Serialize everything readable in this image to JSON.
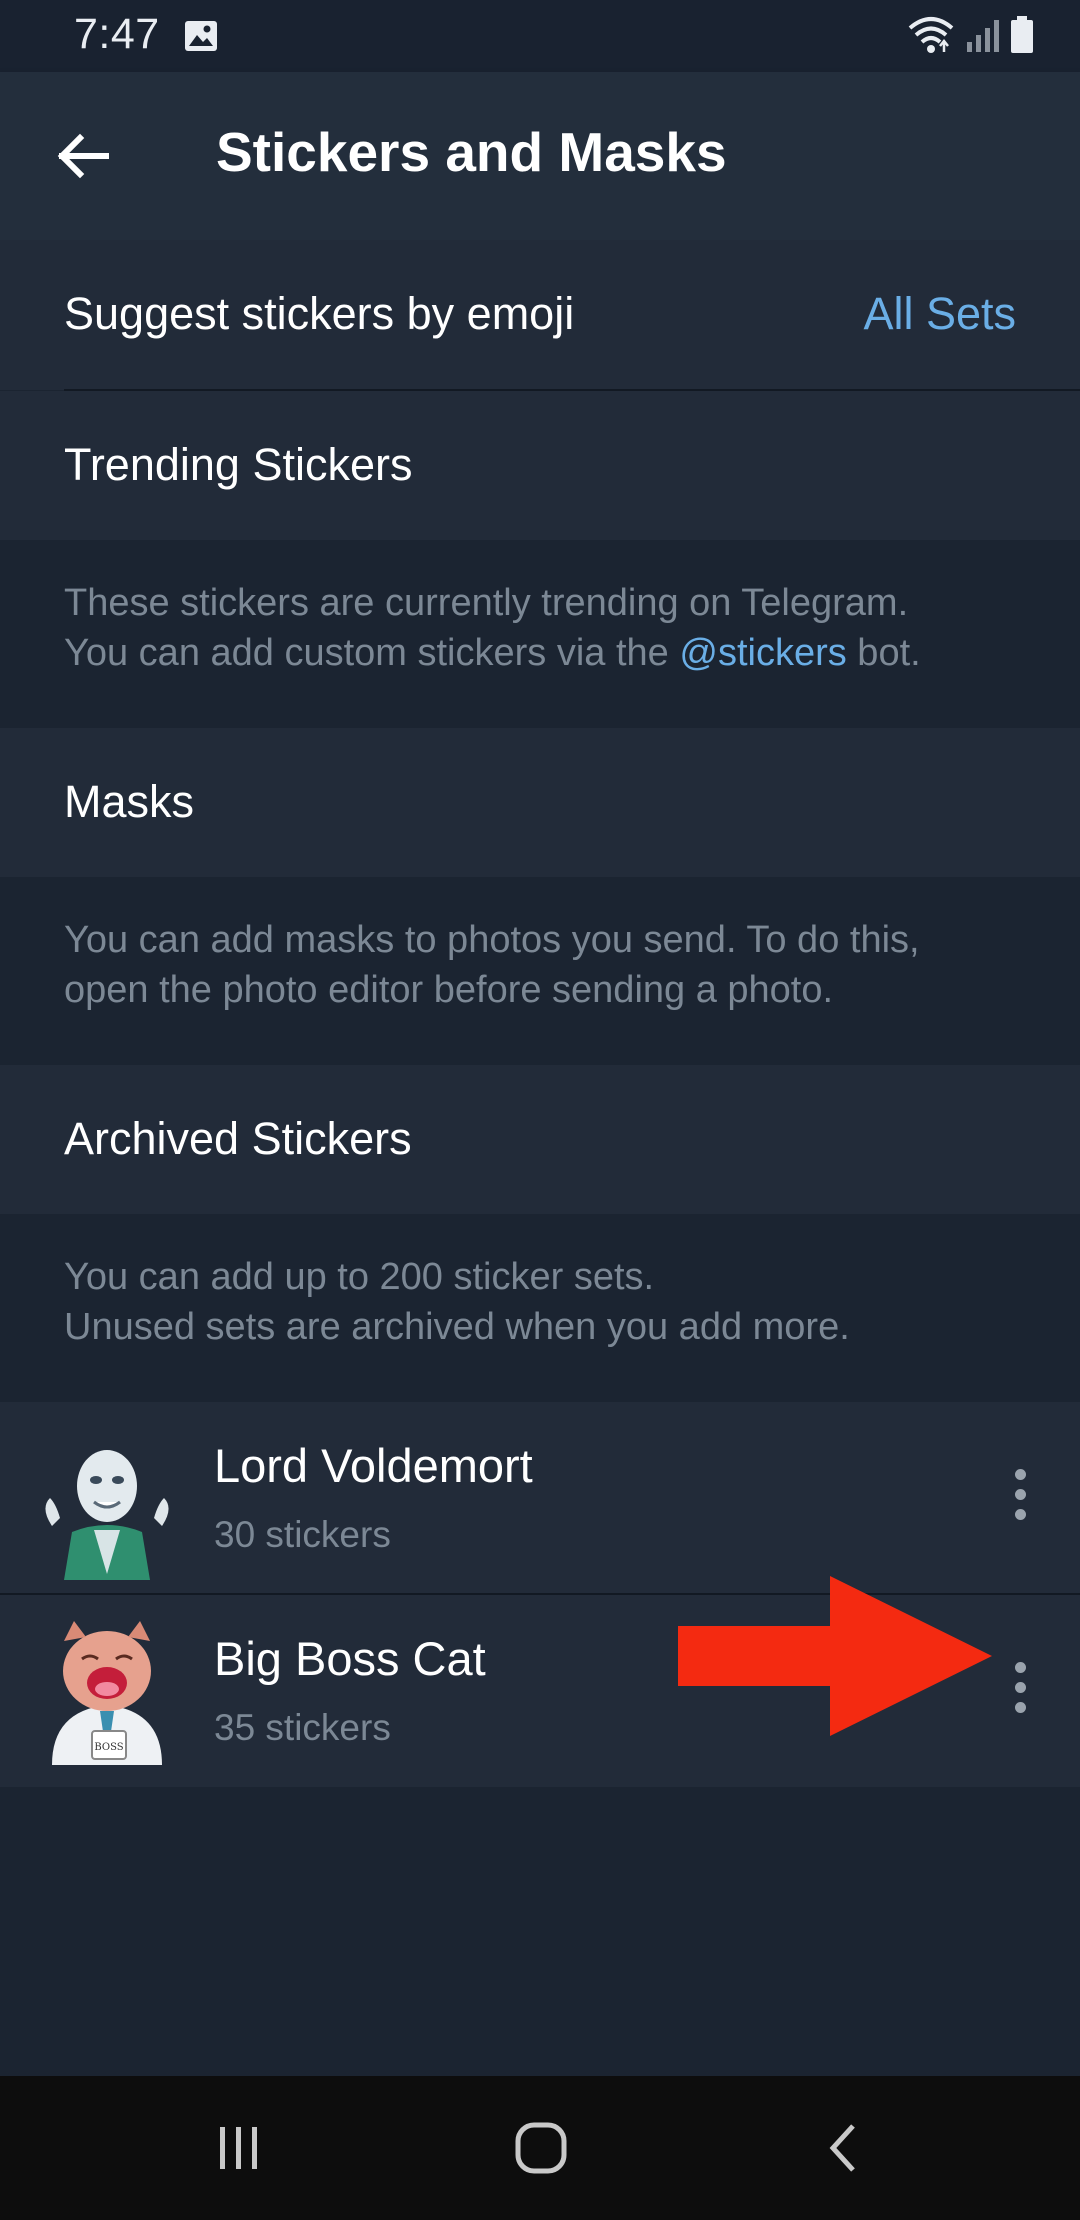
{
  "status_bar": {
    "time": "7:47",
    "icons": [
      "image-icon",
      "wifi-icon",
      "signal-icon",
      "battery-icon"
    ]
  },
  "app_bar": {
    "title": "Stickers and Masks",
    "back_icon": "arrow-left-icon"
  },
  "settings": {
    "suggest_label": "Suggest stickers by emoji",
    "suggest_value": "All Sets",
    "trending_label": "Trending Stickers",
    "trending_info_line1": "These stickers are currently trending on Telegram.",
    "trending_info_line2_pre": "You can add custom stickers via the ",
    "trending_info_link": "@stickers",
    "trending_info_line2_post": " bot.",
    "masks_label": "Masks",
    "masks_info_line1": "You can add masks to photos you send. To do this,",
    "masks_info_line2": "open the photo editor before sending a photo.",
    "archived_label": "Archived Stickers",
    "archived_info_line1": "You can add up to 200 sticker sets.",
    "archived_info_line2": "Unused sets are archived when you add more."
  },
  "sticker_sets": [
    {
      "name": "Lord Voldemort",
      "count": "30 stickers"
    },
    {
      "name": "Big Boss Cat",
      "count": "35 stickers",
      "mug_text": "BOSS"
    }
  ],
  "colors": {
    "accent": "#6aaee6",
    "arrow": "#f42a11",
    "background": "#1b2431",
    "row": "#222b39"
  },
  "nav_bar": {
    "icons": [
      "recents-icon",
      "home-icon",
      "back-icon"
    ]
  }
}
